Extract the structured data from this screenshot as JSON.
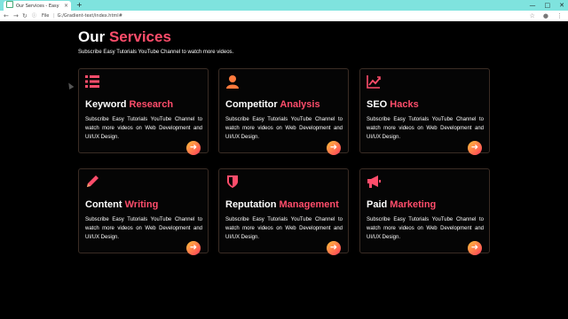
{
  "browser": {
    "tab_title": "Our Services - Easy Tutorials",
    "tab_close": "×",
    "new_tab": "+",
    "address_scheme": "File",
    "address_url": "G:/Gradient-text/index.html#"
  },
  "page": {
    "title_plain": "Our ",
    "title_accent": "Services",
    "subtitle": "Subscribe Easy Tutorials YouTube Channel to watch more videos."
  },
  "colors": {
    "accent": "#ff4d6b",
    "gradient_start": "#ffc23a",
    "gradient_end": "#ff3b5c",
    "background": "#000000",
    "card_border": "#3a2c24"
  },
  "cards": [
    {
      "icon": "list-icon",
      "title_plain": "Keyword ",
      "title_accent": "Research",
      "desc": "Subscribe Easy Tutorials YouTube Channel to watch more videos on Web Development and UI/UX Design."
    },
    {
      "icon": "user-icon",
      "title_plain": "Competitor ",
      "title_accent": "Analysis",
      "desc": "Subscribe Easy Tutorials YouTube Channel to watch more videos on Web Development and UI/UX Design."
    },
    {
      "icon": "chart-line-icon",
      "title_plain": "SEO ",
      "title_accent": "Hacks",
      "desc": "Subscribe Easy Tutorials YouTube Channel to watch more videos on Web Development and UI/UX Design."
    },
    {
      "icon": "pencil-icon",
      "title_plain": "Content ",
      "title_accent": "Writing",
      "desc": "Subscribe Easy Tutorials YouTube Channel to watch more videos on Web Development and UI/UX Design."
    },
    {
      "icon": "shield-icon",
      "title_plain": "Reputation ",
      "title_accent": "Management",
      "desc": "Subscribe Easy Tutorials YouTube Channel to watch more videos on Web Development and UI/UX Design."
    },
    {
      "icon": "megaphone-icon",
      "title_plain": "Paid ",
      "title_accent": "Marketing",
      "desc": "Subscribe Easy Tutorials YouTube Channel to watch more videos on Web Development and UI/UX Design."
    }
  ]
}
